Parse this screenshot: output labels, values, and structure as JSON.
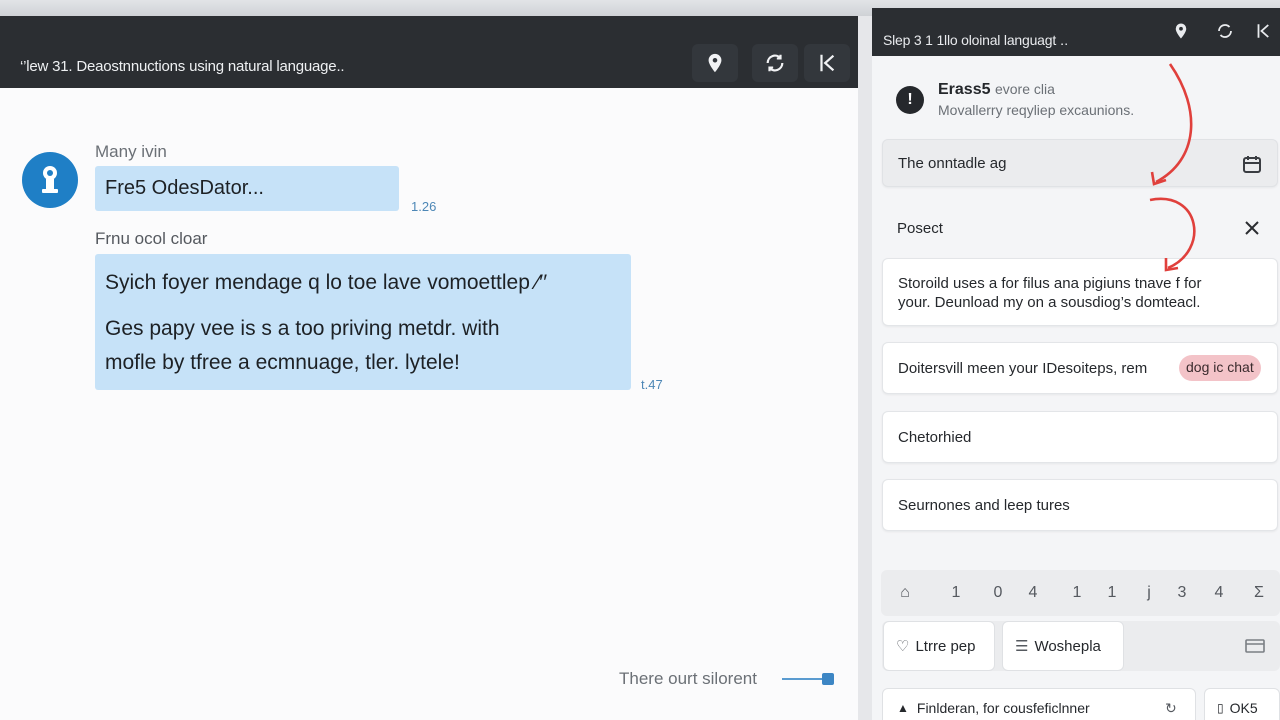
{
  "main": {
    "title": "‘’lew 31. Deaostnnuctions using natural language..",
    "messages": [
      {
        "sender": "Many ivin",
        "text": "Fre5 OdesDator...",
        "time": "1.26"
      },
      {
        "sender": "Frnu ocol cloar",
        "lines": [
          "Syich foyer mendage q lo toe lave vomoettlep ∕′′",
          "Ges papy vee is s a too priving metdr. with",
          "mofle by tfree a ecmnuage, tler. lytele!"
        ],
        "time": "t.47"
      }
    ],
    "footer_text": "There ourt silorent"
  },
  "side": {
    "title": "Slep 3 1 1llo oloinal languagt ․.",
    "info": {
      "title": "Erass5",
      "title_suffix": "evore clia",
      "subtitle": "Movallerry reqyliep excaunions."
    },
    "input_label": "The onntadle ag",
    "section_label": "Posect",
    "cards": [
      {
        "text_line1": "Storoild uses a for filus ana pigiuns tnave f for",
        "text_line2": "your. Deunload my on a sousdiog’s domteacl."
      },
      {
        "text": "Doitersvill meen your IDesoiteps, rem",
        "pill": "dog ic chat"
      },
      {
        "text": "Chetorhied"
      },
      {
        "text": "Seurnones and leep tures"
      }
    ],
    "toolbar": [
      "⌂",
      "1",
      "0",
      "4",
      "1",
      "1",
      "j",
      "3",
      "4",
      "Σ"
    ],
    "buttons": {
      "like": "Ltrre pep",
      "wash": "Woshepla"
    },
    "bottom": {
      "left": "Finlderan, for cousfeficlnner",
      "right": "OK5"
    }
  },
  "colors": {
    "header_bg": "#2b2e32",
    "bubble_bg": "#c6e2f8",
    "avatar": "#1f7fc6",
    "accent_red": "#e0403c",
    "pill_bg": "#f3c3c8"
  }
}
